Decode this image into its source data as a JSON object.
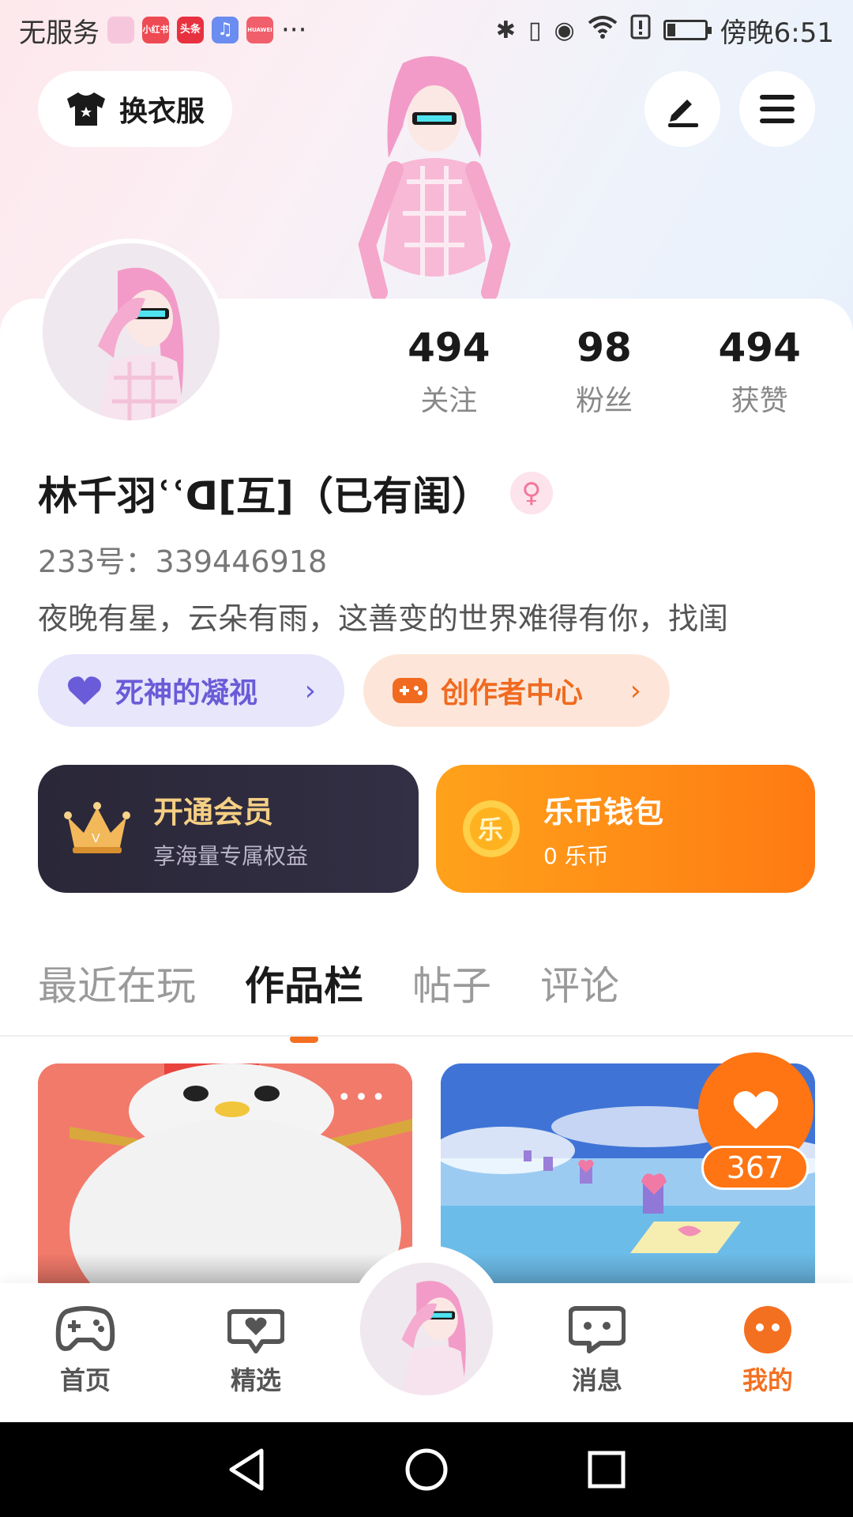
{
  "status_bar": {
    "carrier": "无服务",
    "more": "···",
    "time": "傍晚6:51",
    "app_badges": [
      {
        "name": "photos",
        "color": "#f6c7dc",
        "text": ""
      },
      {
        "name": "xiaohongshu",
        "color": "#ee4a53",
        "text": "小红书"
      },
      {
        "name": "toutiao",
        "color": "#e8313f",
        "text": "头条"
      },
      {
        "name": "music",
        "color": "#6b8cf0",
        "text": "♫"
      },
      {
        "name": "huawei",
        "color": "#f05f6b",
        "text": "HUAWEI"
      }
    ]
  },
  "header": {
    "outfit_label": "换衣服"
  },
  "profile": {
    "stats": [
      {
        "value": "494",
        "label": "关注"
      },
      {
        "value": "98",
        "label": "粉丝"
      },
      {
        "value": "494",
        "label": "获赞"
      }
    ],
    "username": "林千羽ʿʿᗡ[互]（已有闺）",
    "gender_symbol": "♀",
    "uid": "233号：339446918",
    "bio": "夜晚有星，云朵有雨，这善变的世界难得有你，找闺"
  },
  "pills": {
    "left_label": "死神的凝视",
    "right_label": "创作者中心"
  },
  "promos": {
    "vip_title": "开通会员",
    "vip_sub": "享海量专属权益",
    "wallet_title": "乐币钱包",
    "wallet_sub": "0 乐币",
    "coin_char": "乐"
  },
  "tabs": [
    {
      "label": "最近在玩",
      "active": false
    },
    {
      "label": "作品栏",
      "active": true
    },
    {
      "label": "帖子",
      "active": false
    },
    {
      "label": "评论",
      "active": false
    }
  ],
  "works": {
    "like_count": "367",
    "more": "•••"
  },
  "bottom_nav": [
    {
      "label": "首页",
      "icon": "gamepad-icon",
      "active": false
    },
    {
      "label": "精选",
      "icon": "heart-chat-icon",
      "active": false
    },
    {
      "label": "消息",
      "icon": "message-icon",
      "active": false
    },
    {
      "label": "我的",
      "icon": "profile-face-icon",
      "active": true
    }
  ],
  "colors": {
    "accent": "#f37021",
    "vip_gold": "#f5cf84",
    "purple": "#6a5bd8"
  }
}
